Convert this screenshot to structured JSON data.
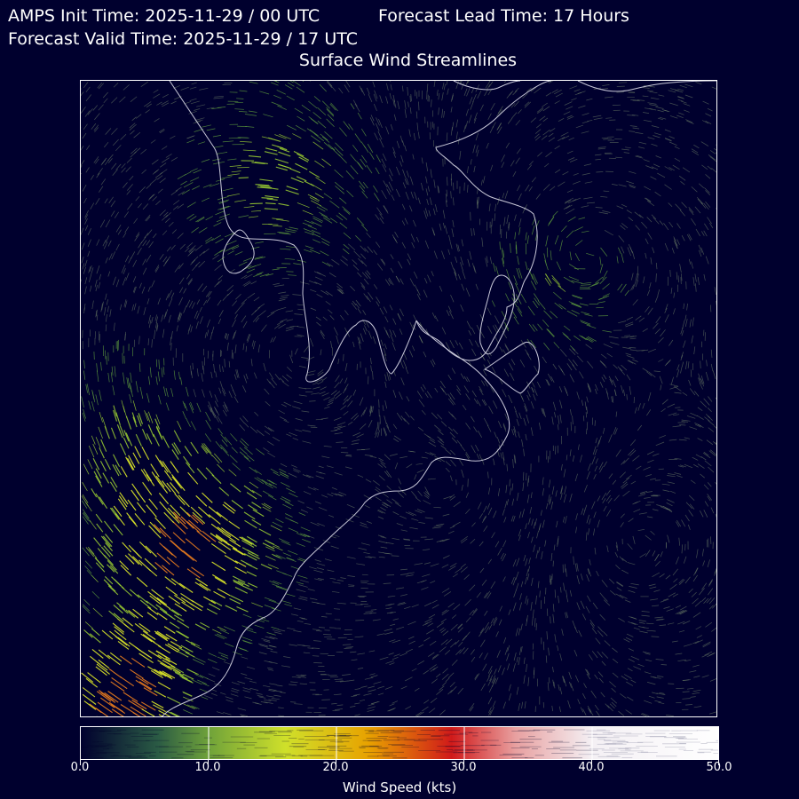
{
  "header": {
    "init_time": "AMPS Init Time: 2025-11-29 / 00 UTC",
    "lead_time": "Forecast Lead Time: 17 Hours",
    "valid_time": "Forecast Valid Time: 2025-11-29 / 17 UTC",
    "title": "Surface Wind Streamlines"
  },
  "colorbar": {
    "label": "Wind Speed (kts)",
    "min": 0,
    "max": 50,
    "ticks": [
      "0.0",
      "10.0",
      "20.0",
      "30.0",
      "40.0",
      "50.0"
    ],
    "colors": [
      "#00002e",
      "#4b8a3c",
      "#cfe02a",
      "#e8a200",
      "#d01a1a",
      "#f0c8c8",
      "#ffffff"
    ]
  },
  "map": {
    "background": "#00002e",
    "coastline_color": "#c8c8d8"
  }
}
